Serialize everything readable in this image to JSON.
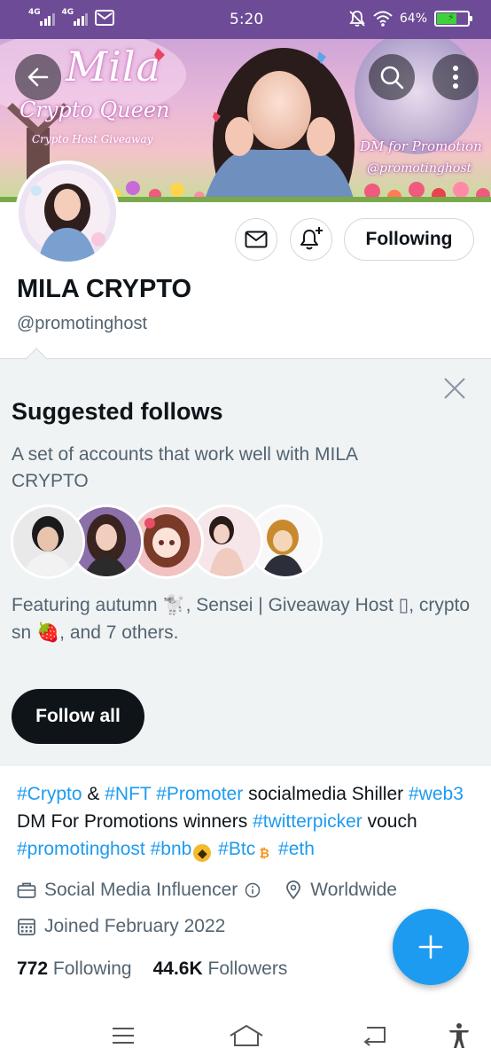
{
  "status_bar": {
    "net1": "4G",
    "net2": "4G",
    "time": "5:20",
    "battery": "64%",
    "icons": [
      "signal-icon",
      "mail-icon",
      "mute-icon",
      "wifi-icon",
      "battery-icon"
    ]
  },
  "banner": {
    "title": "Mila",
    "subtitle": "Crypto Queen",
    "subtitle2": "Crypto Host Giveaway",
    "dm_text": "DM for Promotion",
    "handle_text": "@promotinghost"
  },
  "profile": {
    "display_name": "MILA CRYPTO",
    "handle": "@promotinghost",
    "following_button": "Following"
  },
  "suggested": {
    "title": "Suggested follows",
    "description": "A set of accounts that work well with MILA CRYPTO",
    "featuring": "Featuring autumn 🐩, Sensei | Giveaway Host ▯, crypto sn 🍓, and 7 others.",
    "follow_all": "Follow all"
  },
  "bio": {
    "t1": "#Crypto",
    "t2": " & ",
    "t3": "#NFT",
    "t4": " ",
    "t5": "#Promoter",
    "t6": " socialmedia Shiller ",
    "t7": "#web3",
    "t8": " DM For Promotions winners ",
    "t9": "#twitterpicker",
    "t10": " vouch ",
    "t11": "#promotinghost",
    "t12": " ",
    "t13": "#bnb",
    "t14": " ",
    "t15": "#Btc",
    "t16": " ",
    "t17": "#eth"
  },
  "meta": {
    "category": "Social Media Influencer",
    "location": "Worldwide",
    "joined": "Joined February 2022"
  },
  "counts": {
    "following_num": "772",
    "following_label": "Following",
    "followers_num": "44.6K",
    "followers_label": "Followers"
  },
  "colors": {
    "accent": "#1d9bf0",
    "status_bar": "#6d4b96",
    "text_primary": "#0f1419",
    "text_secondary": "#536471"
  }
}
